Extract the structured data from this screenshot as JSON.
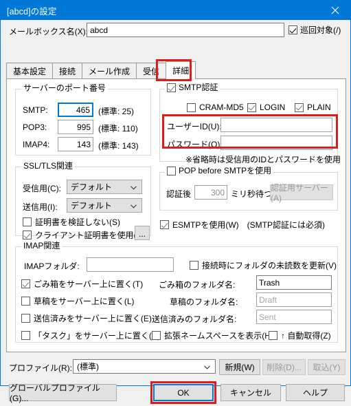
{
  "window": {
    "title": "[abcd]の設定",
    "close_icon": "close-icon"
  },
  "mailbox": {
    "label": "メールボックス名(X):",
    "value": "abcd",
    "patrol_label": "巡回対象(/)",
    "patrol_checked": true
  },
  "tabs": [
    {
      "label": "基本設定",
      "active": false
    },
    {
      "label": "接続",
      "active": false
    },
    {
      "label": "メール作成",
      "active": false
    },
    {
      "label": "受信",
      "active": false
    },
    {
      "label": "詳細",
      "active": true
    }
  ],
  "server_ports": {
    "legend": "サーバーのポート番号",
    "rows": [
      {
        "label": "SMTP:",
        "value": "465",
        "note": "(標準: 25)"
      },
      {
        "label": "POP3:",
        "value": "995",
        "note": "(標準: 110)"
      },
      {
        "label": "IMAP4:",
        "value": "143",
        "note": "(標準: 143)"
      }
    ]
  },
  "smtp_auth": {
    "legend": "SMTP認証",
    "legend_checked": true,
    "methods": [
      {
        "label": "CRAM-MD5",
        "checked": false
      },
      {
        "label": "LOGIN",
        "checked": true
      },
      {
        "label": "PLAIN",
        "checked": true
      }
    ],
    "user_id_label": "ユーザーID(U):",
    "user_id_value": "",
    "password_label": "パスワード(O):",
    "password_value": "",
    "note": "※省略時は受信用のIDとパスワードを使用"
  },
  "ssl_tls": {
    "legend": "SSL/TLS関連",
    "receive_label": "受信用(C):",
    "receive_value": "デフォルト",
    "send_label": "送信用(I):",
    "send_value": "デフォルト",
    "no_verify_label": "証明書を検証しない(S)",
    "no_verify_checked": false,
    "client_cert_label": "クライアント証明書を使用(F)",
    "client_cert_checked": true,
    "browse_label": "..."
  },
  "pop_before_smtp": {
    "legend": "POP before SMTPを使用",
    "legend_checked": false,
    "after_auth_label": "認証後",
    "wait_value": "300",
    "wait_unit_label": "ミリ秒待つ",
    "auth_server_button": "認証用サーバー(A)"
  },
  "esmtp": {
    "label": "ESMTPを使用(W)　(SMTP認証には必須)",
    "checked": true
  },
  "imap": {
    "legend": "IMAP関連",
    "folder_label": "IMAPフォルダ:",
    "folder_value": "",
    "update_unread_label": "接続時にフォルダの未読数を更新(V)",
    "update_unread_checked": false,
    "rows": [
      {
        "checkbox_label": "ごみ箱をサーバー上に置く(T)",
        "checked": true,
        "name_label": "ごみ箱のフォルダ名:",
        "name_value": "Trash",
        "name_enabled": true
      },
      {
        "checkbox_label": "草稿をサーバー上に置く(L)",
        "checked": false,
        "name_label": "草稿のフォルダ名:",
        "name_value": "Draft",
        "name_enabled": false
      },
      {
        "checkbox_label": "送信済みをサーバー上に置く(E)",
        "checked": false,
        "name_label": "送信済みのフォルダ名:",
        "name_value": "Sent",
        "name_enabled": false
      }
    ],
    "task_label": "「タスク」をサーバー上に置く(K)",
    "task_checked": false,
    "namespace_label": "拡張ネームスペースを表示(H)",
    "namespace_checked": false,
    "autoget_label": "↑ 自動取得(Z)",
    "autoget_checked": false
  },
  "profile": {
    "label": "プロファイル(R):",
    "value": "(標準)",
    "new_button": "新規(W)",
    "delete_button": "削除(D)...",
    "import_button": "取込(Y)"
  },
  "footer": {
    "global_profile_button": "グローバルプロファイル(G)...",
    "ok_button": "OK",
    "cancel_button": "キャンセル",
    "help_button": "ヘルプ"
  },
  "colors": {
    "title_bar": "#0078d7",
    "accent": "#0078d7",
    "annotation": "#e01b1b",
    "dialog_bg": "#f0f0f0",
    "page_bg": "#ffffff"
  }
}
